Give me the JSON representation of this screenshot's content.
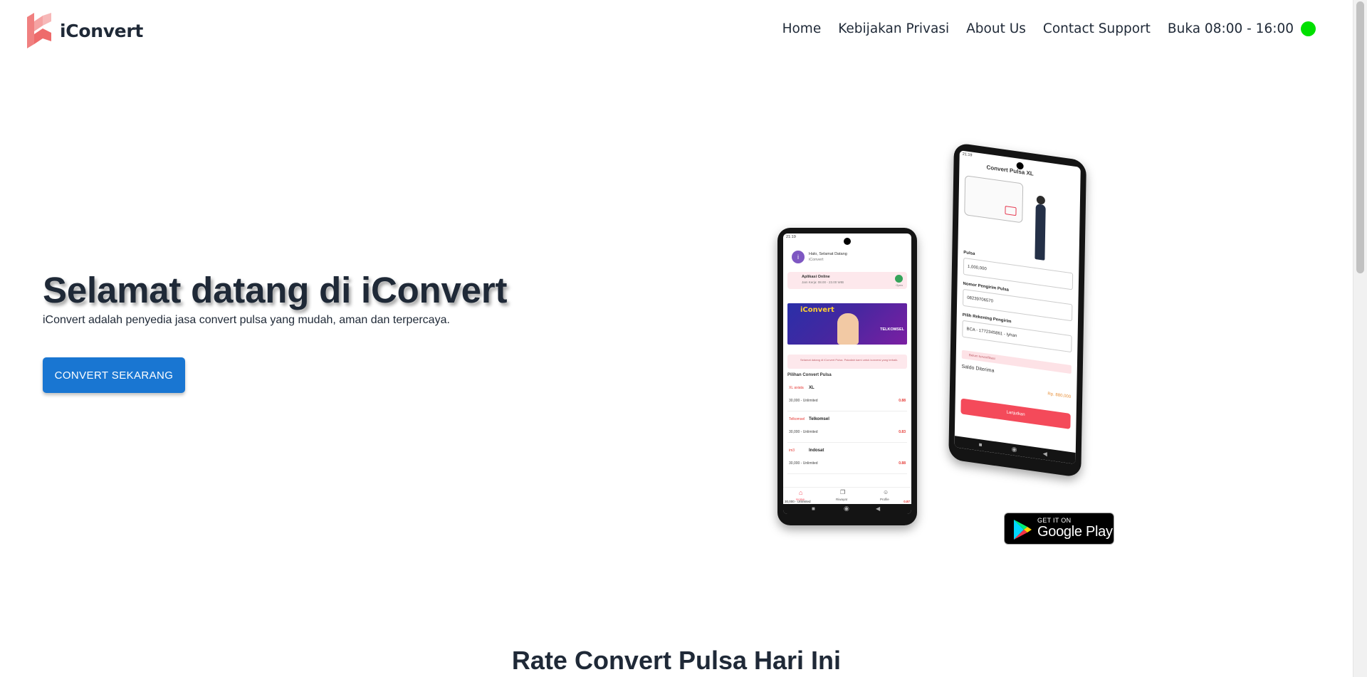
{
  "brand": {
    "name": "iConvert",
    "accent": "#f26d6d"
  },
  "nav": {
    "items": [
      {
        "label": "Home"
      },
      {
        "label": "Kebijakan Privasi"
      },
      {
        "label": "About Us"
      },
      {
        "label": "Contact Support"
      }
    ],
    "hours": "Buka 08:00 - 16:00",
    "status_color": "#00e000"
  },
  "hero": {
    "title": "Selamat datang di iConvert",
    "subtitle": "iConvert adalah penyedia jasa convert pulsa yang mudah, aman dan terpercaya.",
    "cta_label": "CONVERT SEKARANG",
    "cta_color": "#1976d2"
  },
  "phone1": {
    "time": "21:19",
    "greeting": "Halo, Selamat Datang",
    "username": "iConvert",
    "avatar_letter": "i",
    "online_title": "Aplikasi Online",
    "online_hours": "Jam Kerja: 08.00 - 23.00 WIB",
    "online_badge": "Open",
    "banner_title": "iConvert",
    "banner_tel": "TELKOMSEL",
    "notice": "Selamat datang di iConvert Pulsa. Pakailah kami untuk konversi yang terbaik.",
    "list_title": "Pilihan Convert Pulsa",
    "providers": [
      {
        "brand": "XL axiata",
        "name": "XL",
        "range": "30,000 - Unlimited",
        "rate": "0.88"
      },
      {
        "brand": "Telkomsel",
        "name": "Telkomsel",
        "range": "30,000 - Unlimited",
        "rate": "0.83"
      },
      {
        "brand": "im3",
        "name": "Indosat",
        "range": "30,000 - Unlimited",
        "rate": "0.88"
      }
    ],
    "peek_range": "30,000 - Unlimited",
    "peek_rate": "0.87",
    "bottom_nav": [
      "Home",
      "Riwayat",
      "Profile"
    ]
  },
  "phone2": {
    "time": "21:19",
    "title": "Convert Pulsa XL",
    "pulsa_label": "Pulsa",
    "pulsa_value": "1,000,000",
    "sender_label": "Nomor Pengirim Pulsa",
    "sender_value": "08239706570",
    "account_label": "Pilih Rekening Pengirim",
    "account_value": "BCA - 1772345861 - Iyhan",
    "status_text": "Belum terverifikasi",
    "saldo_label": "Saldo Diterima",
    "saldo_value": "Rp. 880,000",
    "submit_label": "Lanjutkan"
  },
  "store_badge": {
    "line1": "GET IT ON",
    "line2": "Google Play"
  },
  "section": {
    "title": "Rate Convert Pulsa Hari Ini"
  }
}
